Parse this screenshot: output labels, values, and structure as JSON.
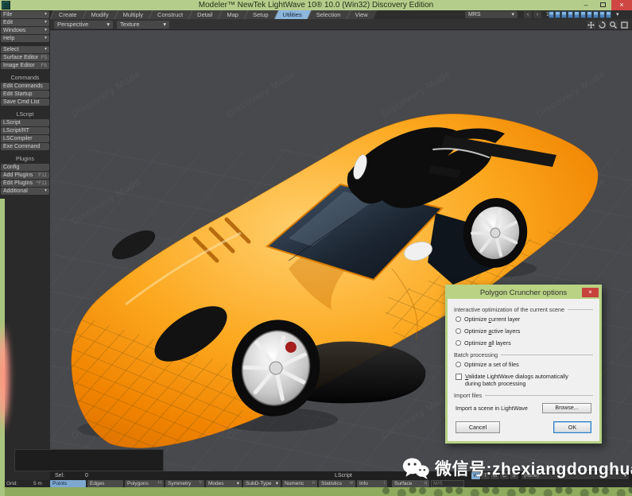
{
  "window": {
    "title": "Modeler™ NewTek LightWave 10® 10.0 (Win32) Discovery Edition",
    "buttons": {
      "minimize": "–",
      "close": "×"
    }
  },
  "icons": {
    "dropdown_arrow": "▾",
    "prev_arrow": "‹",
    "next_arrow": "›"
  },
  "colors": {
    "titlebar_green": "#b5cd8a",
    "active_blue": "#8cb6dc",
    "car_orange": "#f99a14",
    "close_red": "#cf4742",
    "viewport_gray": "#47494d"
  },
  "tabs": [
    {
      "label": "Create",
      "active": false
    },
    {
      "label": "Modify",
      "active": false
    },
    {
      "label": "Multiply",
      "active": false
    },
    {
      "label": "Construct",
      "active": false
    },
    {
      "label": "Detail",
      "active": false
    },
    {
      "label": "Map",
      "active": false
    },
    {
      "label": "Setup",
      "active": false
    },
    {
      "label": "Utilities",
      "active": true
    },
    {
      "label": "Selection",
      "active": false
    },
    {
      "label": "View",
      "active": false
    }
  ],
  "top_right": {
    "preset": "MRS",
    "page": "1",
    "layer_count": 10
  },
  "toolbar2": {
    "view_mode": "Perspective",
    "shading_mode": "Texture"
  },
  "sidebar": {
    "menus": [
      {
        "label": "File"
      },
      {
        "label": "Edit"
      },
      {
        "label": "Windows"
      },
      {
        "label": "Help"
      }
    ],
    "select": [
      {
        "label": "Select"
      },
      {
        "label": "Surface Editor",
        "shortcut": "F5"
      },
      {
        "label": "Image Editor",
        "shortcut": "F6"
      }
    ],
    "sections": [
      {
        "title": "Commands",
        "items": [
          {
            "label": "Edit Commands"
          },
          {
            "label": "Edit Startup"
          },
          {
            "label": "Save Cmd List"
          }
        ]
      },
      {
        "title": "LScript",
        "items": [
          {
            "label": "LScript"
          },
          {
            "label": "LScript/RT"
          },
          {
            "label": "LSCompiler"
          },
          {
            "label": "Exe Command"
          }
        ]
      },
      {
        "title": "Plugins",
        "items": [
          {
            "label": "Config"
          },
          {
            "label": "Add Plugins",
            "shortcut": "F11"
          },
          {
            "label": "Edit Plugins",
            "shortcut": "^F11"
          },
          {
            "label": "Additional"
          }
        ]
      }
    ]
  },
  "viewport": {
    "watermark": "Discovery Mode"
  },
  "dialog": {
    "title": "Polygon Cruncher options",
    "close": "×",
    "group1": {
      "label": "Interactive optimization of the current scene",
      "radios": [
        {
          "pre": "Optimize ",
          "accel": "c",
          "post": "urrent layer"
        },
        {
          "pre": "Optimize ",
          "accel": "a",
          "post": "ctive layers"
        },
        {
          "pre": "Optimize ",
          "accel": "a",
          "post": "ll layers"
        }
      ]
    },
    "group2": {
      "label": "Batch processing",
      "radio_label": "Optimize a set of files",
      "checkbox": {
        "pre": "",
        "accel": "V",
        "post": "alidate LightWave dialogs automatically during batch processing"
      }
    },
    "group3": {
      "label": "Import files",
      "import_label": "Import a scene in LightWave",
      "browse_label": "Browse..."
    },
    "cancel_label": "Cancel",
    "ok_label": "OK"
  },
  "status": {
    "sel_label": "Sel:",
    "sel_value": "0",
    "script_label": "LScript",
    "vmap_buttons": [
      "W",
      "T",
      "M",
      "C",
      "S"
    ],
    "vmap_value": "(none)",
    "grid_label": "Grid:",
    "grid_value": "5 m",
    "mode_buttons": [
      {
        "label": "Points",
        "active": true
      },
      {
        "label": "Edges"
      },
      {
        "label": "Polygons",
        "shortcut": "H"
      },
      {
        "label": "Symmetry",
        "shortcut": "Y"
      },
      {
        "label": "Modes",
        "arrow": true
      },
      {
        "label": "SubD-Type",
        "arrow": true
      },
      {
        "label": "Numeric",
        "shortcut": "n"
      },
      {
        "label": "Statistics",
        "shortcut": "w"
      },
      {
        "label": "Info",
        "shortcut": "i"
      },
      {
        "label": "Surface",
        "shortcut": "q"
      }
    ],
    "surface_field": "M/S"
  },
  "wechat": {
    "text": "微信号:zhexiangdonghua"
  }
}
